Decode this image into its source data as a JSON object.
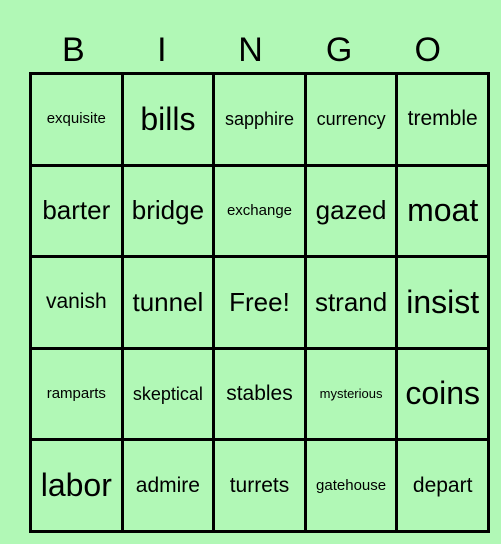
{
  "header": [
    "B",
    "I",
    "N",
    "G",
    "O"
  ],
  "rows": [
    [
      {
        "t": "exquisite",
        "s": "s5"
      },
      {
        "t": "bills",
        "s": "s1"
      },
      {
        "t": "sapphire",
        "s": "s4"
      },
      {
        "t": "currency",
        "s": "s4"
      },
      {
        "t": "tremble",
        "s": "s3"
      }
    ],
    [
      {
        "t": "barter",
        "s": "s2"
      },
      {
        "t": "bridge",
        "s": "s2"
      },
      {
        "t": "exchange",
        "s": "s5"
      },
      {
        "t": "gazed",
        "s": "s2"
      },
      {
        "t": "moat",
        "s": "s1"
      }
    ],
    [
      {
        "t": "vanish",
        "s": "s3"
      },
      {
        "t": "tunnel",
        "s": "s2"
      },
      {
        "t": "Free!",
        "s": "s2"
      },
      {
        "t": "strand",
        "s": "s2"
      },
      {
        "t": "insist",
        "s": "s1"
      }
    ],
    [
      {
        "t": "ramparts",
        "s": "s5"
      },
      {
        "t": "skeptical",
        "s": "s4"
      },
      {
        "t": "stables",
        "s": "s3"
      },
      {
        "t": "mysterious",
        "s": "s6"
      },
      {
        "t": "coins",
        "s": "s1"
      }
    ],
    [
      {
        "t": "labor",
        "s": "s1"
      },
      {
        "t": "admire",
        "s": "s3"
      },
      {
        "t": "turrets",
        "s": "s3"
      },
      {
        "t": "gatehouse",
        "s": "s5"
      },
      {
        "t": "depart",
        "s": "s3"
      }
    ]
  ]
}
